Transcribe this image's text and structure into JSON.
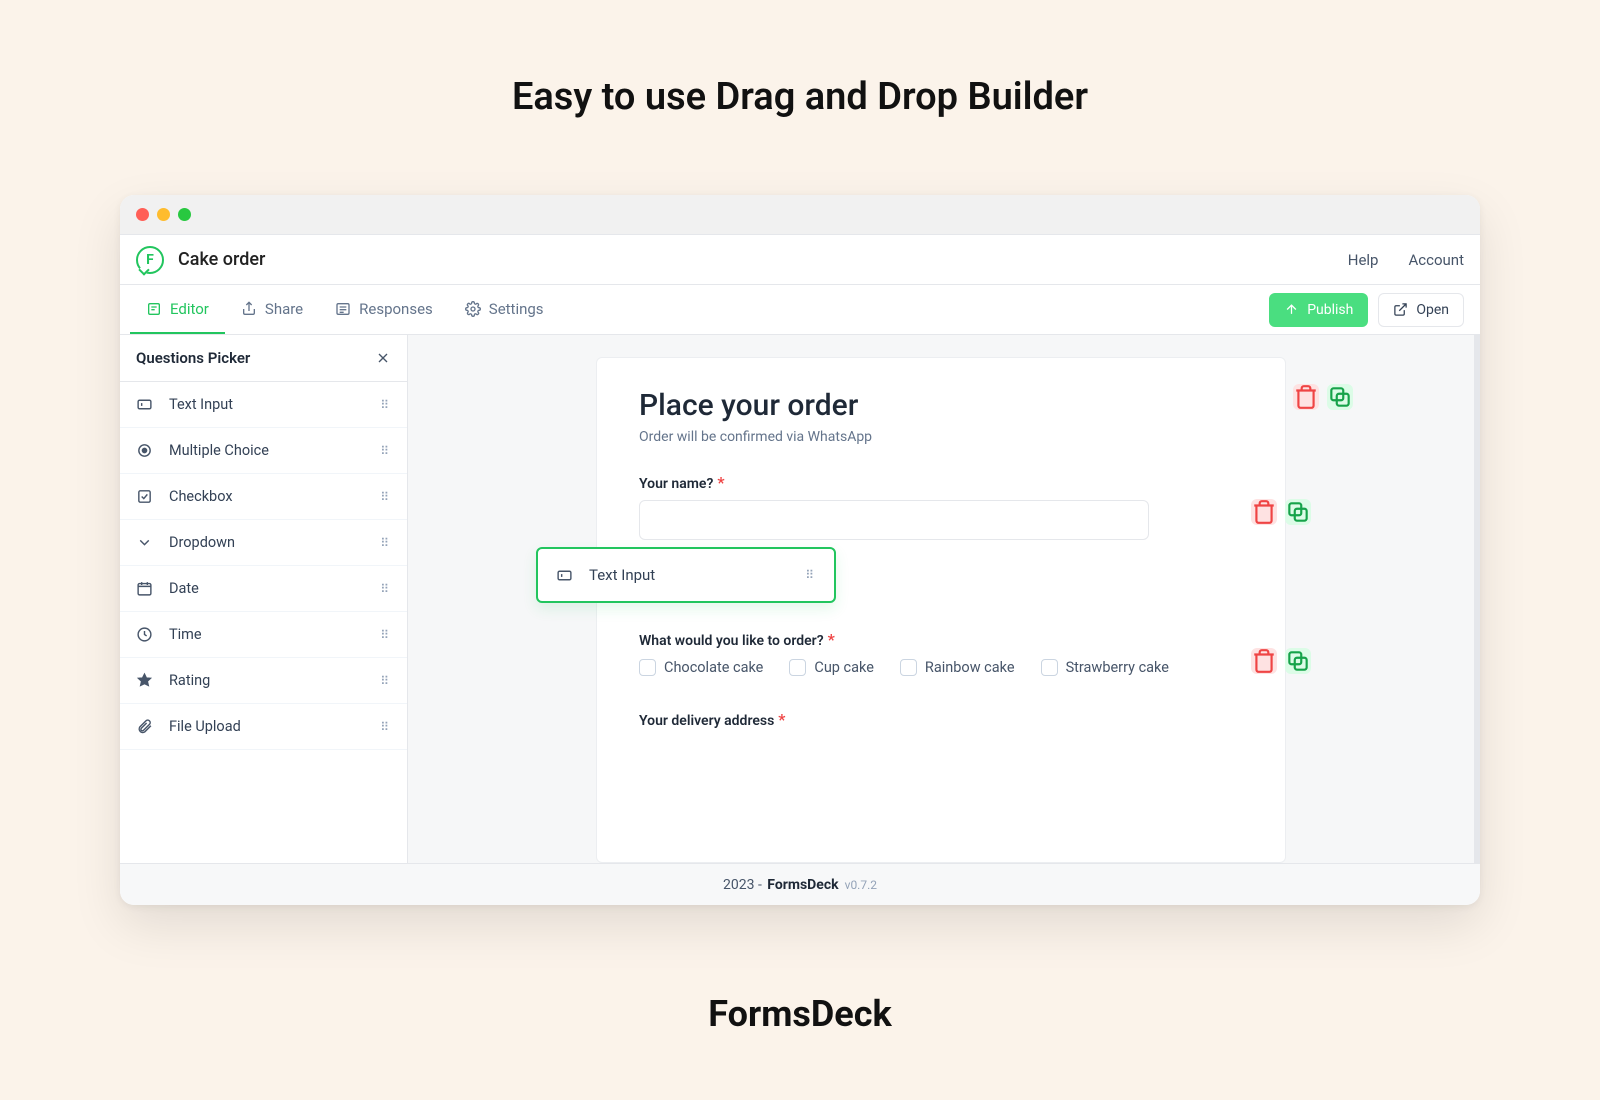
{
  "hero": {
    "title": "Easy to use Drag and Drop Builder"
  },
  "brand": {
    "name": "FormsDeck"
  },
  "header": {
    "app_title": "Cake order",
    "help": "Help",
    "account": "Account"
  },
  "tabs": {
    "editor": "Editor",
    "share": "Share",
    "responses": "Responses",
    "settings": "Settings",
    "publish": "Publish",
    "open": "Open"
  },
  "picker": {
    "title": "Questions Picker",
    "items": [
      {
        "label": "Text Input",
        "icon": "text-input-icon"
      },
      {
        "label": "Multiple Choice",
        "icon": "radio-icon"
      },
      {
        "label": "Checkbox",
        "icon": "checkbox-icon"
      },
      {
        "label": "Dropdown",
        "icon": "dropdown-icon"
      },
      {
        "label": "Date",
        "icon": "calendar-icon"
      },
      {
        "label": "Time",
        "icon": "clock-icon"
      },
      {
        "label": "Rating",
        "icon": "star-icon"
      },
      {
        "label": "File Upload",
        "icon": "paperclip-icon"
      }
    ]
  },
  "drag": {
    "label": "Text Input"
  },
  "form": {
    "title": "Place your order",
    "subtitle": "Order will be confirmed via WhatsApp",
    "q1_label": "Your name?",
    "q2_label": "What would you like to order?",
    "q2_options": [
      "Chocolate cake",
      "Cup cake",
      "Rainbow cake",
      "Strawberry cake"
    ],
    "q3_label": "Your delivery address"
  },
  "footer": {
    "year": "2023",
    "product": "FormsDeck",
    "version": "v0.7.2"
  }
}
